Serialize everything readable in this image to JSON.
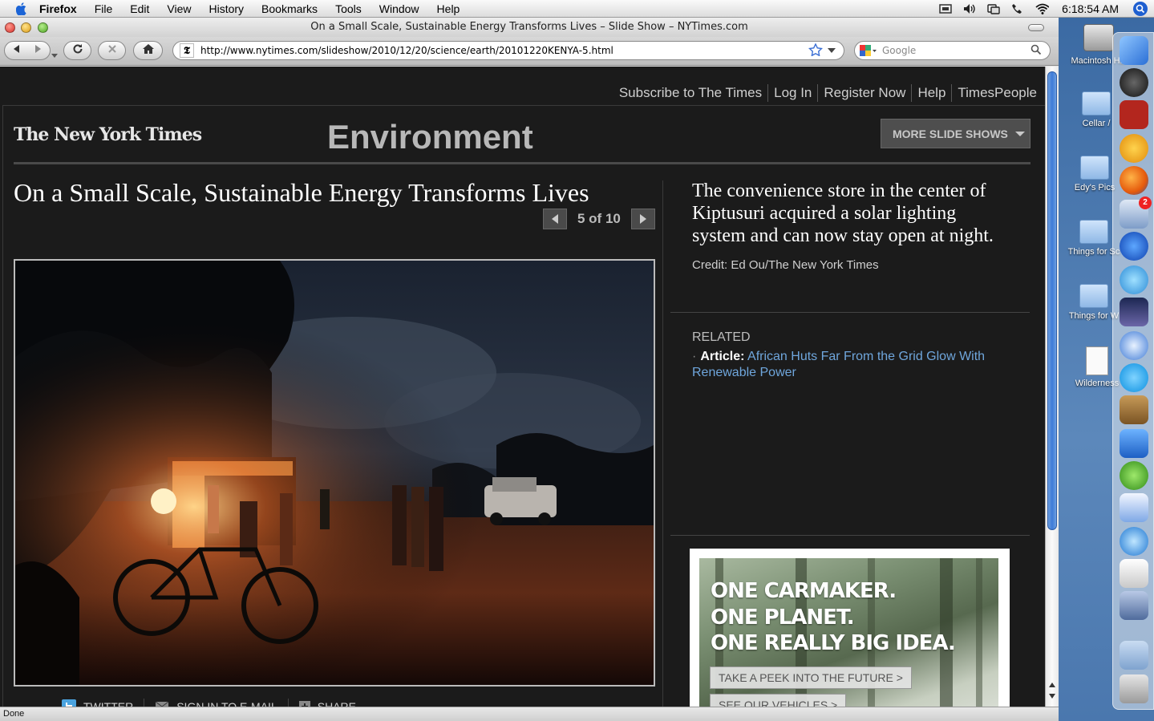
{
  "menubar": {
    "app": "Firefox",
    "items": [
      "File",
      "Edit",
      "View",
      "History",
      "Bookmarks",
      "Tools",
      "Window",
      "Help"
    ],
    "clock": "6:18:54 AM"
  },
  "window": {
    "title": "On a Small Scale, Sustainable Energy Transforms Lives – Slide Show – NYTimes.com",
    "url": "http://www.nytimes.com/slideshow/2010/12/20/science/earth/20101220KENYA-5.html",
    "search_placeholder": "Google",
    "status": "Done"
  },
  "page": {
    "topnav": [
      "Subscribe to The Times",
      "Log In",
      "Register Now",
      "Help",
      "TimesPeople"
    ],
    "logo": "The New York Times",
    "section": "Environment",
    "more_slideshows": "MORE SLIDE SHOWS",
    "headline": "On a Small Scale, Sustainable Energy Transforms Lives",
    "pager": "5 of 10",
    "caption": "The convenience store in the center of Kiptusuri acquired a solar lighting system and can now stay open at night.",
    "credit": "Credit: Ed Ou/The New York Times",
    "related_heading": "RELATED",
    "related_prefix": "Article:",
    "related_link": "African Huts Far From the Grid Glow With Renewable Power",
    "share": {
      "twitter": "TWITTER",
      "email": "SIGN IN TO E-MAIL",
      "share": "SHARE"
    },
    "ad": {
      "line1": "ONE CARMAKER.",
      "line2": "ONE PLANET.",
      "line3": "ONE REALLY BIG IDEA.",
      "btn1": "TAKE A PEEK INTO THE FUTURE  >",
      "btn2": "SEE OUR VEHICLES  >"
    }
  },
  "desktop": {
    "icons": [
      "Macintosh HD",
      "Cellar /",
      "Edy's Pics",
      "Things for Sc",
      "Things for W",
      "Wilderness"
    ]
  },
  "dock": {
    "items": [
      "finder-icon",
      "dashboard-icon",
      "dictionary-icon",
      "money-icon",
      "firefox-icon",
      "mail-stamp-icon",
      "earth-icon",
      "messenger-icon",
      "night-app-icon",
      "safari-icon",
      "skype-icon",
      "address-book-icon",
      "word-icon",
      "lime-icon",
      "preview-icon",
      "itunes-icon",
      "textedit-icon",
      "iphoto-icon",
      "radiation-folder-icon",
      "trash-icon"
    ],
    "badge": "2"
  }
}
